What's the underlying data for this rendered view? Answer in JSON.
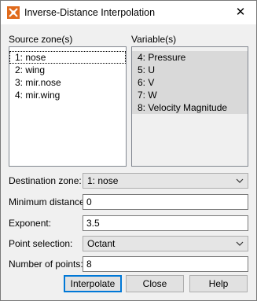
{
  "dialog": {
    "title": "Inverse-Distance Interpolation",
    "close_glyph": "✕",
    "icon": "tecplot-app-icon"
  },
  "source_zones": {
    "label": "Source zone(s)",
    "items": [
      {
        "label": "1: nose",
        "focused": true
      },
      {
        "label": "2: wing"
      },
      {
        "label": "3: mir.nose"
      },
      {
        "label": "4: mir.wing"
      }
    ]
  },
  "variables": {
    "label": "Variable(s)",
    "items": [
      {
        "label": "4: Pressure",
        "selected": true
      },
      {
        "label": "5: U",
        "selected": true
      },
      {
        "label": "6: V",
        "selected": true
      },
      {
        "label": "7: W",
        "selected": true
      },
      {
        "label": "8: Velocity Magnitude",
        "selected": true
      }
    ]
  },
  "destination_zone": {
    "label": "Destination zone:",
    "value": "1: nose"
  },
  "minimum_distance": {
    "label": "Minimum distance:",
    "value": "0"
  },
  "exponent": {
    "label": "Exponent:",
    "value": "3.5"
  },
  "point_selection": {
    "label": "Point selection:",
    "value": "Octant"
  },
  "number_of_points": {
    "label": "Number of points:",
    "value": "8"
  },
  "buttons": {
    "interpolate": "Interpolate",
    "close": "Close",
    "help": "Help"
  },
  "colors": {
    "accent": "#0078d7",
    "selection": "#d9d9d9",
    "window_bg": "#f0f0f0"
  }
}
